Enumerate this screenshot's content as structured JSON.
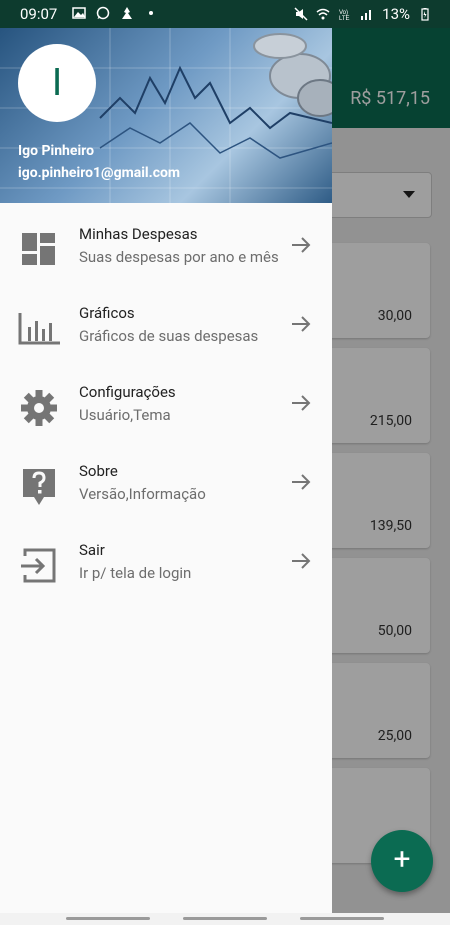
{
  "status_bar": {
    "time": "09:07",
    "battery": "13%",
    "icons": [
      "image-icon",
      "whatsapp-icon",
      "app-icon",
      "dot-icon",
      "mute-icon",
      "wifi-icon",
      "volte-icon",
      "signal-icon",
      "battery-icon"
    ]
  },
  "app": {
    "balance": "R$  517,15",
    "expenses": [
      "30,00",
      "215,00",
      "139,50",
      "50,00",
      "25,00"
    ],
    "fab_label": "+"
  },
  "drawer": {
    "avatar_letter": "I",
    "user_name": "Igo Pinheiro",
    "user_email": "igo.pinheiro1@gmail.com",
    "items": [
      {
        "title": "Minhas Despesas",
        "subtitle": "Suas despesas por ano e mês",
        "icon": "dashboard-icon"
      },
      {
        "title": "Gráficos",
        "subtitle": "Gráficos de suas despesas",
        "icon": "bar-chart-icon"
      },
      {
        "title": "Configurações",
        "subtitle": "Usuário,Tema",
        "icon": "gear-icon"
      },
      {
        "title": "Sobre",
        "subtitle": "Versão,Informação",
        "icon": "help-icon"
      },
      {
        "title": "Sair",
        "subtitle": "Ir p/ tela de login",
        "icon": "logout-icon"
      }
    ]
  },
  "colors": {
    "primary": "#0b6b52",
    "status_bar": "#0d3b2e",
    "icon_grey": "#757575"
  }
}
